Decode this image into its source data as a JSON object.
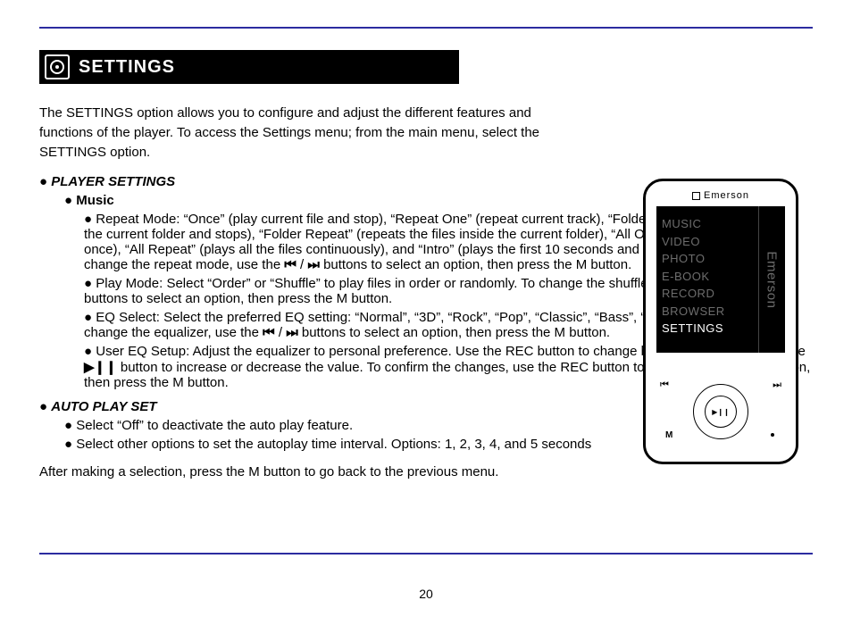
{
  "heading": "SETTINGS",
  "description": "The SETTINGS option allows you to configure and adjust the different features and functions of the player. To access the Settings menu; from the main menu, select the SETTINGS option.",
  "options": {
    "player": {
      "title": "PLAYER SETTINGS",
      "music": {
        "label": "Music",
        "repeat": "Repeat Mode: “Once” (play current file and stop), “Repeat One” (repeat current track), “Folder Once” (plays files inside the current folder and stops), “Folder Repeat” (repeats the files inside the current folder), “All Once” (plays all the files once), “All Repeat” (plays all the files continuously), and “Intro” (plays the first 10 seconds and skips to the next file). To change the repeat mode, use the",
        "repeat_tail": "buttons to select an option, then press the M button.",
        "play_mode": "Play Mode: Select “Order” or “Shuffle” to play files in order or randomly. To change the shuffle mode, use the",
        "play_mode_tail": "buttons to select an option, then press the M button.",
        "eq": "EQ Select: Select the preferred EQ setting: “Normal”, “3D”, “Rock”, “Pop”, “Classic”, “Bass”, “Jazz”, and “User EQ”. To change the equalizer, use the",
        "eq_tail": "buttons to select an option, then press the M button.",
        "user_eq": "User EQ Setup: Adjust the equalizer to personal preference. Use the REC button to change between the bands, use the",
        "user_eq_tail": "button to increase or decrease the value. To confirm the changes, use the REC button to navigate to the YES option, then press the M button."
      }
    },
    "autoplay": {
      "title": "AUTO PLAY SET",
      "line1": "Select “Off” to deactivate the auto play feature.",
      "line2": "Select other options to set the autoplay time interval. Options: 1, 2, 3, 4, and 5 seconds"
    }
  },
  "last_line": "After making a selection, press the M button to go back to the previous menu.",
  "page_number": "20",
  "icons": {
    "prev": "⏮",
    "next": "⏭",
    "playpause": "▶❙❙",
    "bullet": "●"
  },
  "device": {
    "brand": "Emerson",
    "side_brand": "Emerson",
    "menu": [
      "MUSIC",
      "VIDEO",
      "PHOTO",
      "E-BOOK",
      "RECORD",
      "BROWSER"
    ],
    "selected": "SETTINGS",
    "btn_m": "M",
    "btn_play": "▶❙❙",
    "btn_prev": "⏮",
    "btn_next": "⏭"
  }
}
